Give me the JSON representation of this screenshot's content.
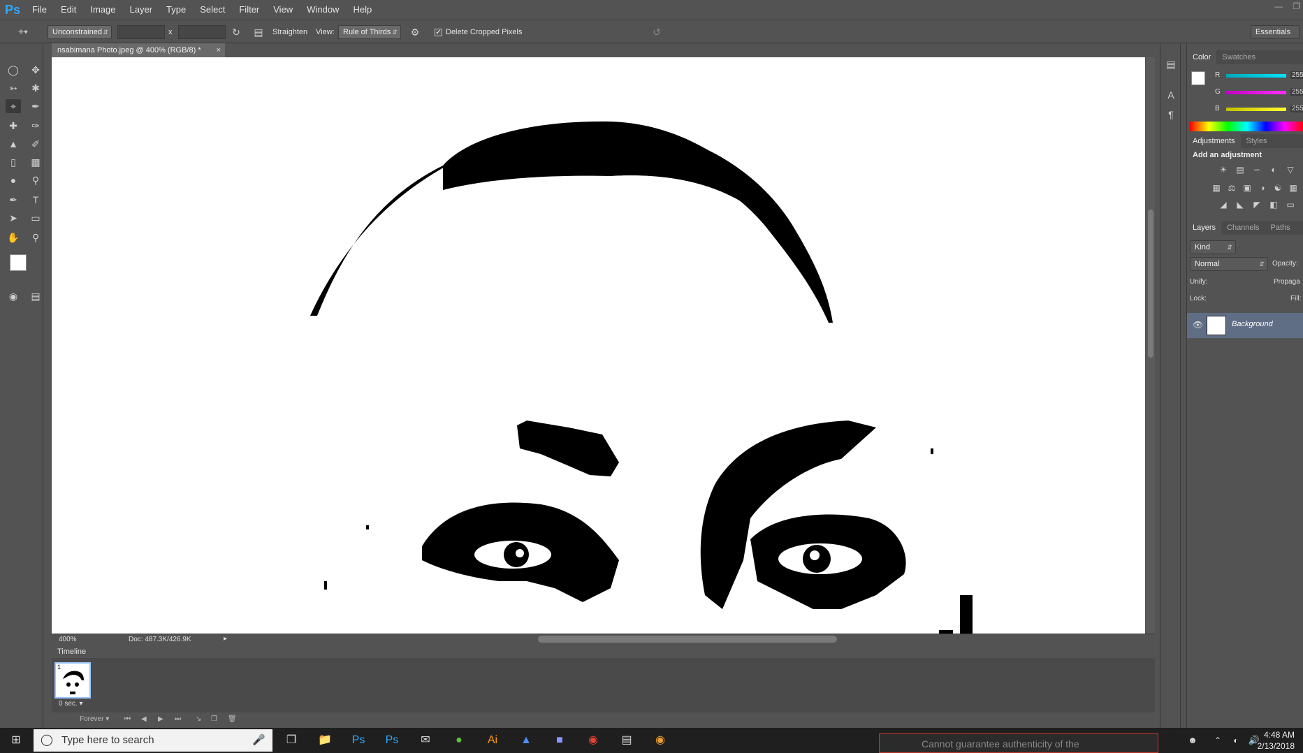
{
  "menubar": {
    "logo": "Ps",
    "items": [
      "File",
      "Edit",
      "Image",
      "Layer",
      "Type",
      "Select",
      "Filter",
      "View",
      "Window",
      "Help"
    ]
  },
  "options": {
    "ratio_value": "Unconstrained",
    "x_sep": "x",
    "straighten_label": "Straighten",
    "view_label": "View:",
    "view_value": "Rule of Thirds",
    "delete_cropped_label": "Delete Cropped Pixels",
    "delete_cropped_checked": true,
    "workspace": "Essentials"
  },
  "document": {
    "tab_title": "nsabimana Photo.jpeg @ 400% (RGB/8) *",
    "close": "×",
    "zoom": "400%",
    "doc_info": "Doc: 487.3K/426.9K"
  },
  "timeline": {
    "title": "Timeline",
    "frame_number": "1",
    "frame_delay": "0 sec.",
    "loop": "Forever"
  },
  "panels": {
    "color_tabs": [
      "Color",
      "Swatches"
    ],
    "rgb": [
      {
        "label": "R",
        "value": "255",
        "color": "#00e5ff"
      },
      {
        "label": "G",
        "value": "255",
        "color": "#ff30ff"
      },
      {
        "label": "B",
        "value": "255",
        "color": "#ffff30"
      }
    ],
    "adjust_tabs": [
      "Adjustments",
      "Styles"
    ],
    "adjust_title": "Add an adjustment",
    "layer_tabs": [
      "Layers",
      "Channels",
      "Paths"
    ],
    "kind": "Kind",
    "blend_mode": "Normal",
    "opacity_label": "Opacity:",
    "unify_label": "Unify:",
    "propagate_label": "Propaga",
    "lock_label": "Lock:",
    "fill_label": "Fill:",
    "layer_name": "Background"
  },
  "taskbar": {
    "search_placeholder": "Type here to search",
    "time": "4:48 AM",
    "date": "2/13/2018",
    "notification": "Cannot guarantee authenticity of the"
  },
  "colors": {
    "ui_bg": "#535353",
    "accent": "#31a8ff",
    "selected_layer": "#5f6e85"
  }
}
